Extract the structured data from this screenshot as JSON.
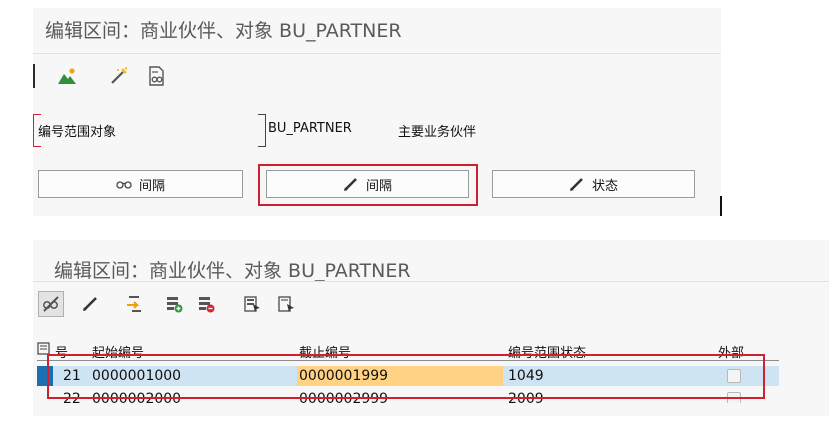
{
  "top_panel": {
    "title": "编辑区间：商业伙伴、对象 BU_PARTNER",
    "toolbar_icons": [
      "landscape-icon",
      "magic-wand-icon",
      "document-glasses-icon"
    ],
    "object_label": "编号范围对象",
    "object_value": "BU_PARTNER",
    "object_description": "主要业务伙伴",
    "buttons": {
      "intervals_display": "间隔",
      "intervals_change": "间隔",
      "status_change": "状态"
    }
  },
  "bottom_panel": {
    "title": "编辑区间：商业伙伴、对象 BU_PARTNER",
    "toolbar_icons": [
      "glasses-toggle-icon",
      "pencil-icon",
      "transfer-icon",
      "insert-row-icon",
      "delete-row-icon",
      "select-all-icon",
      "deselect-all-icon"
    ],
    "table": {
      "columns": [
        "号",
        "起始编号",
        "截止编号",
        "编号范围状态",
        "外部"
      ],
      "rows": [
        {
          "no": "21",
          "from": "0000001000",
          "to": "0000001999",
          "status": "1049",
          "external": false
        },
        {
          "no": "22",
          "from": "0000002000",
          "to": "0000002999",
          "status": "2009",
          "external": false
        }
      ]
    }
  },
  "colors": {
    "highlight_red": "#d2202e",
    "selected_row": "#cfe4f2",
    "edited_cell": "#ffd383",
    "row_selector": "#1b6fb3"
  }
}
